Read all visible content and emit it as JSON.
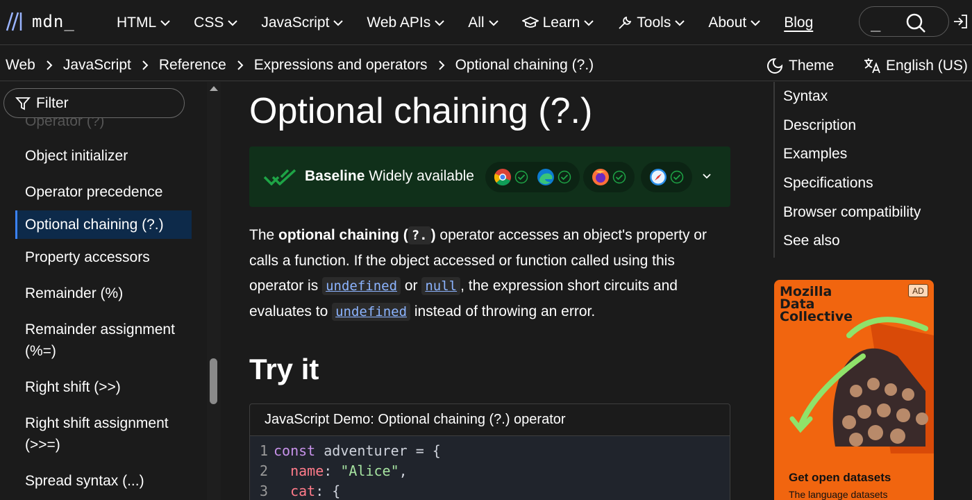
{
  "header": {
    "logo_text": "mdn_",
    "nav": [
      {
        "label": "HTML"
      },
      {
        "label": "CSS"
      },
      {
        "label": "JavaScript"
      },
      {
        "label": "Web APIs"
      },
      {
        "label": "All"
      },
      {
        "label": "Learn"
      },
      {
        "label": "Tools"
      },
      {
        "label": "About"
      }
    ],
    "blog_label": "Blog",
    "search_value": "_"
  },
  "breadcrumbs": [
    "Web",
    "JavaScript",
    "Reference",
    "Expressions and operators",
    "Optional chaining (?.)"
  ],
  "toolbar": {
    "theme_label": "Theme",
    "language_label": "English (US)"
  },
  "sidebar": {
    "filter_placeholder": "Filter",
    "items": [
      {
        "label": "Operator (?)"
      },
      {
        "label": "Object initializer"
      },
      {
        "label": "Operator precedence"
      },
      {
        "label": "Optional chaining (?.)",
        "active": true
      },
      {
        "label": "Property accessors"
      },
      {
        "label": "Remainder (%)"
      },
      {
        "label": "Remainder assignment (%=)"
      },
      {
        "label": "Right shift (>>)"
      },
      {
        "label": "Right shift assignment (>>=)"
      },
      {
        "label": "Spread syntax (...)"
      }
    ]
  },
  "article": {
    "title": "Optional chaining (?.)",
    "baseline_strong": "Baseline",
    "baseline_status": "Widely available",
    "browsers": [
      "chrome-icon",
      "edge-icon",
      "firefox-icon",
      "safari-icon"
    ],
    "intro": {
      "p1": "The ",
      "strong": "optional chaining (",
      "code": "?.",
      "strong_end": ")",
      "p2": " operator accesses an object's property or calls a function. If the object accessed or function called using this operator is ",
      "link1": "undefined",
      "p3": " or ",
      "link2": "null",
      "p4": ", the expression short circuits and evaluates to ",
      "link3": "undefined",
      "p5": " instead of throwing an error."
    },
    "try_title": "Try it",
    "demo_title": "JavaScript Demo: Optional chaining (?.) operator",
    "code_lines": [
      {
        "n": "1",
        "kw": "const",
        "rest": " adventurer = {"
      },
      {
        "n": "2",
        "prop": "  name",
        "sep": ": ",
        "str": "\"Alice\"",
        "end": ","
      },
      {
        "n": "3",
        "prop": "  cat",
        "sep": ": {",
        "str": "",
        "end": ""
      }
    ]
  },
  "toc": [
    "Syntax",
    "Description",
    "Examples",
    "Specifications",
    "Browser compatibility",
    "See also"
  ],
  "ad": {
    "brand": "Mozilla\nData\nCollective",
    "badge": "AD",
    "headline": "Get open datasets",
    "sub": "The language datasets"
  },
  "colors": {
    "background": "#1b1b1b",
    "baseline_bg": "#10301a",
    "baseline_check": "#1ea446",
    "link": "#8cb4ff",
    "active_item_bg": "#0d2a4a",
    "ad_orange": "#f1650f"
  }
}
